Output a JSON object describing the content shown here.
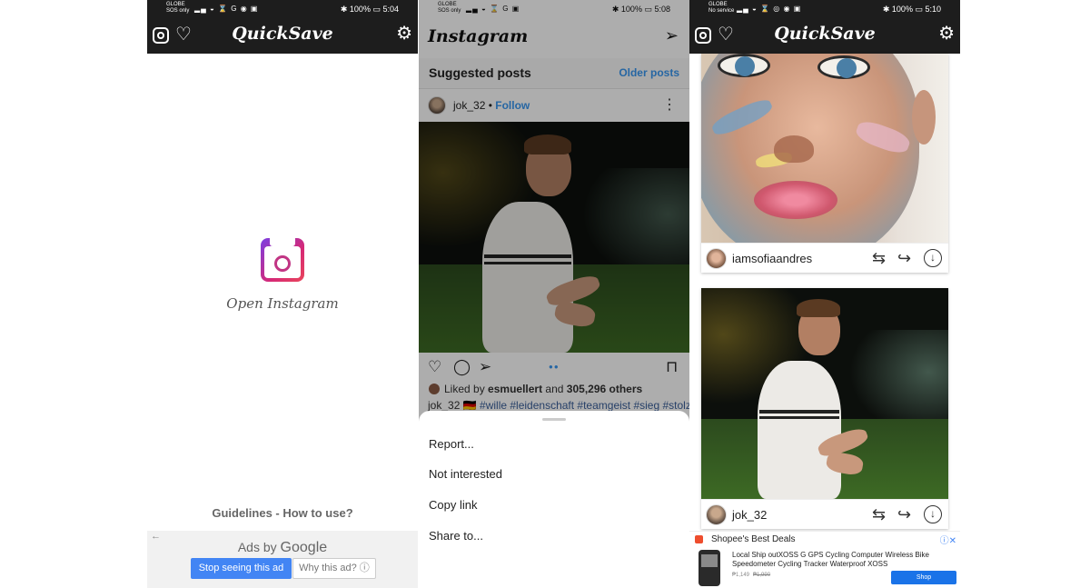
{
  "panel1": {
    "status": {
      "carrier_line1": "GLOBE",
      "carrier_line2": "SOS only",
      "battery": "100%",
      "time": "5:04"
    },
    "app_title": "QuickSave",
    "open_instagram_label": "Open Instagram",
    "guidelines_link": "Guidelines - How to use?",
    "ad": {
      "ads_by": "Ads by",
      "google": "Google",
      "stop_button": "Stop seeing this ad",
      "why_button": "Why this ad? ⓘ"
    }
  },
  "panel2": {
    "status": {
      "carrier_line1": "GLOBE",
      "carrier_line2": "SOS only",
      "battery": "100%",
      "time": "5:08"
    },
    "app_wordmark": "Instagram",
    "suggested_title": "Suggested posts",
    "older_posts": "Older posts",
    "post": {
      "username": "jok_32",
      "follow": "Follow",
      "liked_prefix": "Liked by",
      "liked_user": "esmuellert",
      "liked_and": "and",
      "liked_count": "305,296 others",
      "caption_user": "jok_32",
      "caption_flag": "🇩🇪",
      "caption_tags": "#wille #leidenschaft #teamgeist #sieg #stolz"
    },
    "sheet_items": [
      "Report...",
      "Not interested",
      "Copy link",
      "Share to..."
    ]
  },
  "panel3": {
    "status": {
      "carrier_line1": "GLOBE",
      "carrier_line2": "No service",
      "battery": "100%",
      "time": "5:10"
    },
    "app_title": "QuickSave",
    "cards": [
      {
        "username": "iamsofiaandres"
      },
      {
        "username": "jok_32"
      }
    ],
    "shopee_ad": {
      "title": "Shopee's Best Deals",
      "description": "Local Ship outXOSS G GPS Cycling Computer Wireless Bike Speedometer Cycling Tracker Waterproof XOSS",
      "price": "₱1,149",
      "old_price": "₱1,990",
      "button": "Shop"
    }
  }
}
